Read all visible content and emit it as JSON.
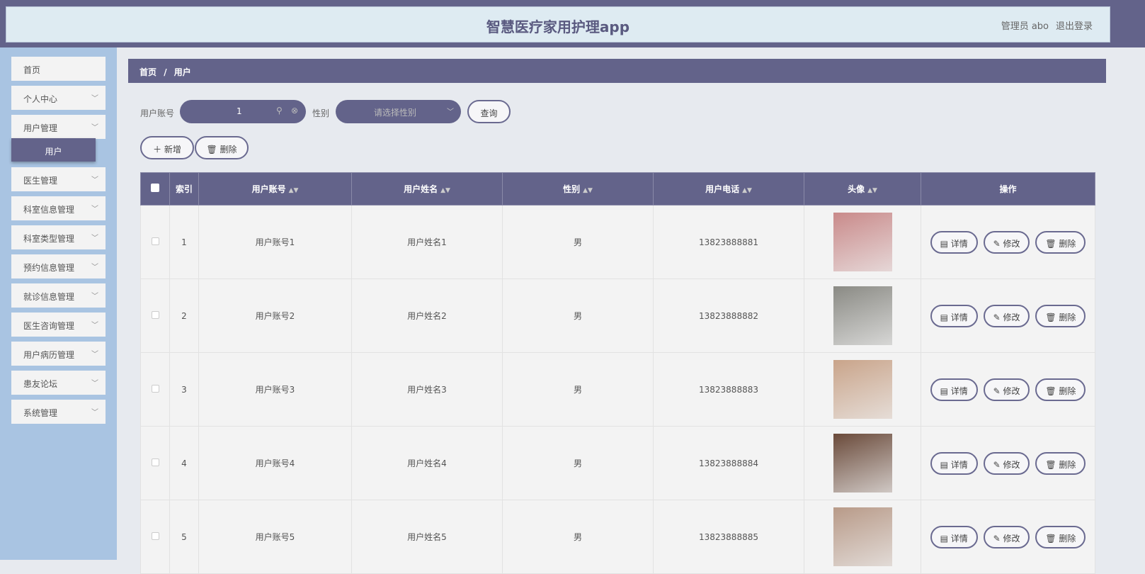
{
  "header": {
    "title": "智慧医疗家用护理app",
    "user": "管理员 abo",
    "logout": "退出登录"
  },
  "sidebar": {
    "items": [
      {
        "label": "首页"
      },
      {
        "label": "个人中心"
      },
      {
        "label": "用户管理"
      },
      {
        "label": "医生管理"
      },
      {
        "label": "科室信息管理"
      },
      {
        "label": "科室类型管理"
      },
      {
        "label": "预约信息管理"
      },
      {
        "label": "就诊信息管理"
      },
      {
        "label": "医生咨询管理"
      },
      {
        "label": "用户病历管理"
      },
      {
        "label": "患友论坛"
      },
      {
        "label": "系统管理"
      }
    ],
    "active_sub": "用户"
  },
  "breadcrumb": {
    "home": "首页",
    "sep": "/",
    "current": "用户"
  },
  "search": {
    "account_label": "用户账号",
    "account_value": "1",
    "gender_label": "性别",
    "gender_placeholder": "请选择性别",
    "query": "查询"
  },
  "actions": {
    "add": "新增",
    "delete": "删除"
  },
  "table": {
    "headers": [
      "索引",
      "用户账号",
      "用户姓名",
      "性别",
      "用户电话",
      "头像",
      "操作"
    ],
    "ops": {
      "detail": "详情",
      "edit": "修改",
      "delete": "删除"
    },
    "rows": [
      {
        "index": "1",
        "account": "用户账号1",
        "name": "用户姓名1",
        "gender": "男",
        "phone": "13823888881",
        "avatar_color": "#c98a8a"
      },
      {
        "index": "2",
        "account": "用户账号2",
        "name": "用户姓名2",
        "gender": "男",
        "phone": "13823888882",
        "avatar_color": "#8a8a84"
      },
      {
        "index": "3",
        "account": "用户账号3",
        "name": "用户姓名3",
        "gender": "男",
        "phone": "13823888883",
        "avatar_color": "#c9a48a"
      },
      {
        "index": "4",
        "account": "用户账号4",
        "name": "用户姓名4",
        "gender": "男",
        "phone": "13823888884",
        "avatar_color": "#6a4a3a"
      },
      {
        "index": "5",
        "account": "用户账号5",
        "name": "用户姓名5",
        "gender": "男",
        "phone": "13823888885",
        "avatar_color": "#b89a88"
      }
    ]
  }
}
